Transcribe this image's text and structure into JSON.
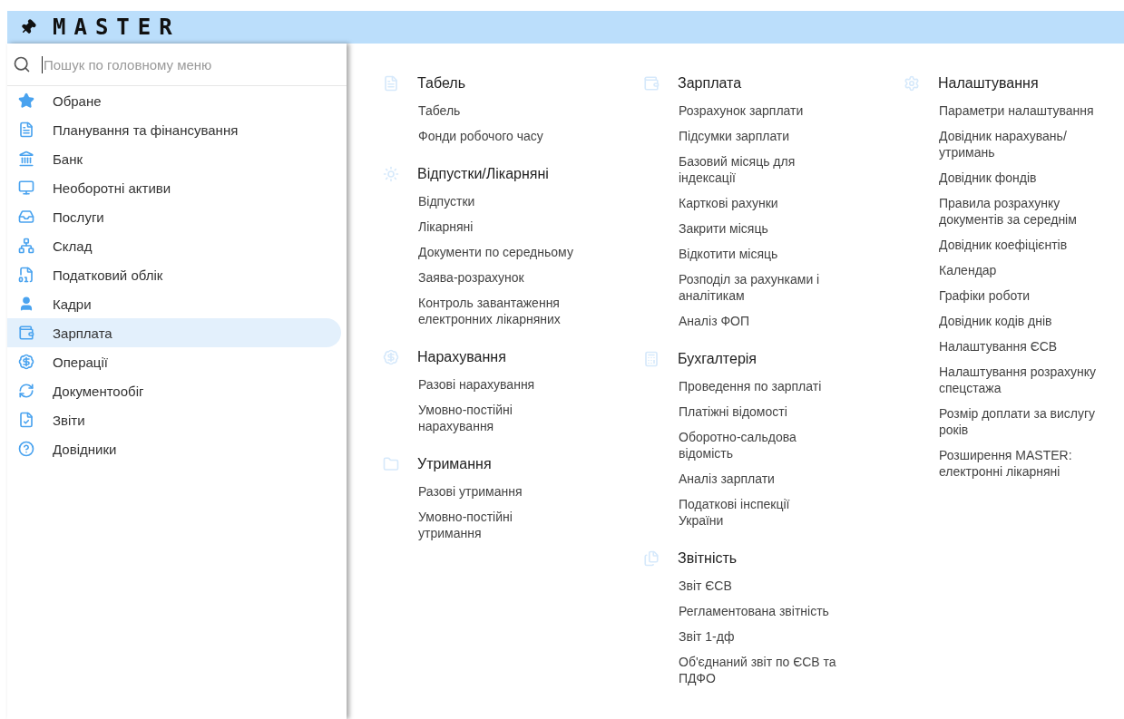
{
  "header": {
    "title": "MASTER"
  },
  "search": {
    "placeholder": "Пошук по головному меню"
  },
  "sidebar": {
    "items": [
      {
        "label": "Обране",
        "selected": false
      },
      {
        "label": "Планування та фінансування",
        "selected": false
      },
      {
        "label": "Банк",
        "selected": false
      },
      {
        "label": "Необоротні активи",
        "selected": false
      },
      {
        "label": "Послуги",
        "selected": false
      },
      {
        "label": "Склад",
        "selected": false
      },
      {
        "label": "Податковий облік",
        "selected": false
      },
      {
        "label": "Кадри",
        "selected": false
      },
      {
        "label": "Зарплата",
        "selected": true
      },
      {
        "label": "Операції",
        "selected": false
      },
      {
        "label": "Документообіг",
        "selected": false
      },
      {
        "label": "Звіти",
        "selected": false
      },
      {
        "label": "Довідники",
        "selected": false
      }
    ]
  },
  "columns": [
    {
      "sections": [
        {
          "title": "Табель",
          "items": [
            "Табель",
            "Фонди робочого часу"
          ]
        },
        {
          "title": "Відпустки/Лікарняні",
          "items": [
            "Відпустки",
            "Лікарняні",
            "Документи по середньому",
            "Заява-розрахунок",
            "Контроль завантаження\nелектронних лікарняних"
          ]
        },
        {
          "title": "Нарахування",
          "items": [
            "Разові нарахування",
            "Умовно-постійні\nнарахування"
          ]
        },
        {
          "title": "Утримання",
          "items": [
            "Разові утримання",
            "Умовно-постійні\nутримання"
          ]
        }
      ]
    },
    {
      "sections": [
        {
          "title": "Зарплата",
          "items": [
            "Розрахунок зарплати",
            "Підсумки зарплати",
            "Базовий місяць для\nіндексації",
            "Карткові рахунки",
            "Закрити місяць",
            "Відкотити місяць",
            "Розподіл за рахунками і\nаналітикам",
            "Аналіз ФОП"
          ]
        },
        {
          "title": "Бухгалтерія",
          "items": [
            "Проведення по зарплаті",
            "Платіжні відомості",
            "Оборотно-сальдова\nвідомість",
            "Аналіз зарплати",
            "Податкові інспекції\nУкраїни"
          ]
        },
        {
          "title": "Звітність",
          "items": [
            "Звіт ЄСВ",
            "Регламентована звітність",
            "Звіт 1-дф",
            "Об'єднаний звіт по ЄСВ та\nПДФО"
          ]
        }
      ]
    },
    {
      "sections": [
        {
          "title": "Налаштування",
          "items": [
            "Параметри налаштування",
            "Довідник нарахувань/\nутримань",
            "Довідник фондів",
            "Правила розрахунку\nдокументів за середнім",
            "Довідник коефіцієнтів",
            "Календар",
            "Графіки роботи",
            "Довідник кодів днів",
            "Налаштування ЄСВ",
            "Налаштування розрахунку\nспецстажа",
            "Розмір доплати за вислугу\nроків",
            "Розширення MASTER:\nелектронні лікарняні"
          ]
        }
      ]
    }
  ]
}
